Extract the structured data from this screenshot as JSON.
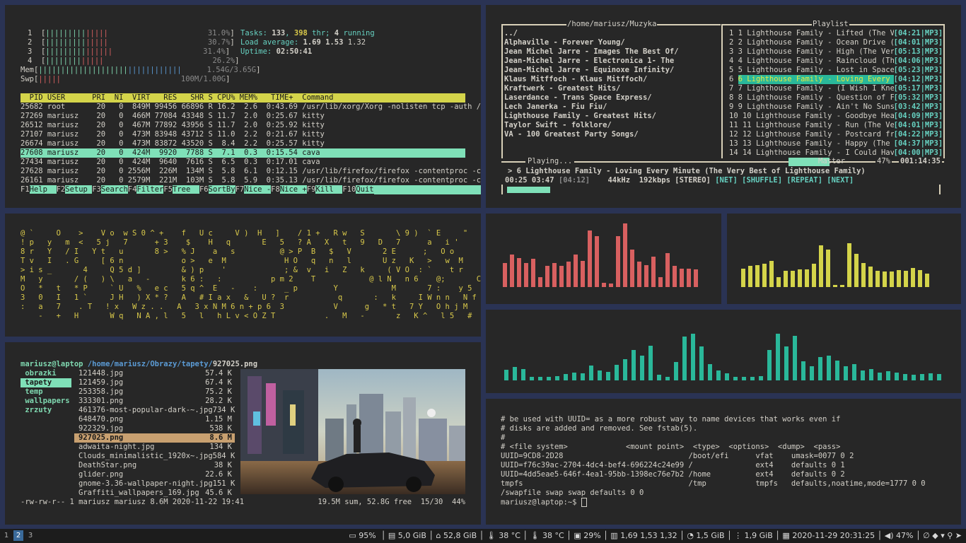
{
  "htop": {
    "cpu_meters": [
      {
        "n": "1",
        "bar": "|||||||||",
        "bar_r": "|||||",
        "pct": "31.0%"
      },
      {
        "n": "2",
        "bar": "|||||||||",
        "bar_r": "|||||",
        "pct": "30.7%"
      },
      {
        "n": "3",
        "bar": "|||||||||",
        "bar_r": "||||||",
        "pct": "31.4%"
      },
      {
        "n": "4",
        "bar": "||||||||",
        "bar_r": "|||||",
        "pct": "26.2%"
      }
    ],
    "mem": {
      "label": "Mem",
      "bar": "||||||||||||||||||||",
      "bar_b": "||||||||||||",
      "val": "1.54G/3.65G"
    },
    "swp": {
      "label": "Swp",
      "bar_r": "|||||",
      "val": "100M/1.00G"
    },
    "tasks": {
      "prefix": "Tasks: ",
      "tasks": "133",
      "sep": ", ",
      "thr": "398",
      "thr_label": " thr; ",
      "running": "4",
      "running_label": " running"
    },
    "load": {
      "prefix": "Load average: ",
      "l1": "1.69",
      "l5": "1.53",
      "l15": "1.32"
    },
    "uptime": {
      "prefix": "Uptime: ",
      "value": "02:50:41"
    },
    "header": "  PID USER      PRI  NI  VIRT   RES   SHR S CPU% MEM%   TIME+  Command",
    "processes": [
      {
        "line": "25682 root       20   0  849M 99456 66896 R 16.2  2.6  0:43.69 /usr/lib/xorg/Xorg -nolisten tcp -auth /",
        "selected": false
      },
      {
        "line": "27269 mariusz    20   0  466M 77084 43348 S 11.7  2.0  0:25.67 kitty",
        "selected": false
      },
      {
        "line": "26512 mariusz    20   0  467M 77892 43956 S 11.7  2.0  0:25.92 kitty",
        "selected": false
      },
      {
        "line": "27107 mariusz    20   0  473M 83948 43712 S 11.0  2.2  0:21.67 kitty",
        "selected": false
      },
      {
        "line": "26674 mariusz    20   0  473M 83872 43520 S  8.4  2.2  0:25.57 kitty",
        "selected": false
      },
      {
        "line": "27608 mariusz    20   0  424M  9920  7788 S  7.1  0.3  0:15.54 cava",
        "selected": true
      },
      {
        "line": "27434 mariusz    20   0  424M  9640  7616 S  6.5  0.3  0:17.01 cava",
        "selected": false
      },
      {
        "line": "27628 mariusz    20   0 2556M  226M  134M S  5.8  6.1  0:12.15 /usr/lib/firefox/firefox -contentproc -c",
        "selected": false
      },
      {
        "line": "26161 mariusz    20   0 2579M  221M  103M S  5.8  5.9  0:35.13 /usr/lib/firefox/firefox -contentproc -c",
        "selected": false
      }
    ],
    "fkeys": [
      {
        "k": "F1",
        "l": "Help  "
      },
      {
        "k": "F2",
        "l": "Setup "
      },
      {
        "k": "F3",
        "l": "Search"
      },
      {
        "k": "F4",
        "l": "Filter"
      },
      {
        "k": "F5",
        "l": "Tree  "
      },
      {
        "k": "F6",
        "l": "SortBy"
      },
      {
        "k": "F7",
        "l": "Nice -"
      },
      {
        "k": "F8",
        "l": "Nice +"
      },
      {
        "k": "F9",
        "l": "Kill  "
      },
      {
        "k": "F10",
        "l": "Quit"
      }
    ]
  },
  "cmus": {
    "browser_title": "/home/mariusz/Muzyka",
    "browser_items": [
      "../",
      "Alphaville - Forever Young/",
      "Jean Michel Jarre - Images The Best Of/",
      "Jean-Michel Jarre - Electronica 1- The",
      "Jean-Michel Jarre - Equinoxe Infinity/",
      "Klaus Mitffoch - Klaus Mitffoch/",
      "Kraftwerk - Greatest Hits/",
      "Laserdance - Trans Space Express/",
      "Lech Janerka - Fiu Fiu/",
      "Lighthouse Family - Greatest Hits/",
      "Taylor Swift - folklore/",
      "VA - 100 Greatest Party Songs/"
    ],
    "playlist_title": "Playlist",
    "playlist": [
      {
        "n": "1 ",
        "t": "1 Lighthouse Family - Lifted (The Ver",
        "d": "[04:21|MP3]"
      },
      {
        "n": "2 ",
        "t": "2 Lighthouse Family - Ocean Drive (Th",
        "d": "[04:01|MP3]"
      },
      {
        "n": "3 ",
        "t": "3 Lighthouse Family - High (The Very ",
        "d": "[05:13|MP3]"
      },
      {
        "n": "4 ",
        "t": "4 Lighthouse Family - Raincloud (The ",
        "d": "[04:06|MP3]"
      },
      {
        "n": "5 ",
        "t": "5 Lighthouse Family - Lost in Space (",
        "d": "[05:23|MP3]"
      },
      {
        "n": "6 ",
        "t": "6 Lighthouse Family - Loving Every Mi",
        "d": "[04:12|MP3]"
      },
      {
        "n": "7 ",
        "t": "7 Lighthouse Family - (I Wish I Knew ",
        "d": "[05:17|MP3]"
      },
      {
        "n": "8 ",
        "t": "8 Lighthouse Family - Question of Fai",
        "d": "[05:32|MP3]"
      },
      {
        "n": "9 ",
        "t": "9 Lighthouse Family - Ain't No Sunshi",
        "d": "[03:42|MP3]"
      },
      {
        "n": "10",
        "t": " 10 Lighthouse Family - Goodbye Heartb",
        "d": "[04:09|MP3]"
      },
      {
        "n": "11",
        "t": " 11 Lighthouse Family - Run (The Very ",
        "d": "[04:01|MP3]"
      },
      {
        "n": "12",
        "t": " 12 Lighthouse Family - Postcard from ",
        "d": "[04:22|MP3]"
      },
      {
        "n": "13",
        "t": " 13 Lighthouse Family - Happy (The Ver",
        "d": "[04:37|MP3]"
      },
      {
        "n": "14",
        "t": " 14 Lighthouse Family - I Could Have L",
        "d": "[04:00|MP3]"
      }
    ],
    "playing_label": "Playing...",
    "volume_label": "Master",
    "volume_pct": "47%",
    "elapsed_total": "001:14:35",
    "now_playing": "> 6 Lighthouse Family - Loving Every Minute (The Very Best of Lighthouse Family)",
    "time_pos": "00:25 03:47",
    "duration": "[04:12]",
    "khz": "44kHz",
    "kbps": "192kbps",
    "stereo": "[STEREO]",
    "flags": "[NET] [SHUFFLE] [REPEAT] [NEXT]",
    "volume_level": 0.47,
    "progress_level": 0.1
  },
  "matrix": {
    "rows": [
      "@ `     O    >    V o  w S 0 ^ +    f   U c     V )  H   ]    / 1 +   R w   S       \\ 9 )  ` E     \"",
      "! p   y   m  <   5 j   7      + 3    $    H   q       E   5   ? A   X   t   9   D   7      a   i '      r",
      "8 r   Y   / I   Y t   u       8 >   % J    a   s          @ > P  B   $   V       2 E      ;   O o      n",
      "T v   I   . G     [ 6 n             o >   e  M             H O   q   n   l       U z   K   >   w  M     d",
      "> i s _       4     Q 5 d ]         & ) p    '             ; &  v   i   Z   k     ( V O  : `    t r     r",
      "M   y       / (   ) \\   a   -       k 6 :   :           p m 2    T            @ l N   n 6    @;       C",
      "O   *   t   * P     ` U   %   e c   5 q ^  E   -    :      _ p        Y            M       7 :    y 5   Z / i",
      "3   0   I   1 `     J H   ) X * ?   A   # I a x   &   U ?  r           q       :   k     I W n n   N f   O h s",
      ":   a   7    . T   ! x   W z . .   A   3 x N M 6 n + p 6  3           V      g   * t   7 Y   O h j M   r H",
      "    -   +   H       W q   N A , l   5   l   h L v < O Z T           .   M   -       z   K ^   l 5   #   \\ c"
    ]
  },
  "vis": {
    "red": [
      0.28,
      0.38,
      0.34,
      0.28,
      0.33,
      0.12,
      0.25,
      0.28,
      0.25,
      0.3,
      0.38,
      0.31,
      0.67,
      0.6,
      0.05,
      0.04,
      0.6,
      0.75,
      0.44,
      0.3,
      0.26,
      0.36,
      0.12,
      0.4,
      0.25,
      0.22,
      0.22,
      0.21
    ],
    "yellow": [
      0.24,
      0.27,
      0.28,
      0.3,
      0.34,
      0.13,
      0.21,
      0.21,
      0.23,
      0.23,
      0.3,
      0.54,
      0.48,
      0.03,
      0.03,
      0.56,
      0.43,
      0.31,
      0.26,
      0.21,
      0.2,
      0.2,
      0.22,
      0.21,
      0.25,
      0.22,
      0.17
    ],
    "teal": [
      0.15,
      0.19,
      0.16,
      0.05,
      0.05,
      0.05,
      0.06,
      0.09,
      0.11,
      0.1,
      0.21,
      0.14,
      0.12,
      0.22,
      0.3,
      0.43,
      0.35,
      0.49,
      0.08,
      0.05,
      0.26,
      0.62,
      0.66,
      0.48,
      0.23,
      0.14,
      0.1,
      0.05,
      0.05,
      0.05,
      0.06,
      0.43,
      0.66,
      0.48,
      0.63,
      0.27,
      0.2,
      0.33,
      0.35,
      0.28,
      0.2,
      0.23,
      0.14,
      0.16,
      0.11,
      0.13,
      0.11,
      0.09,
      0.08,
      0.09,
      0.1,
      0.09
    ],
    "colors": {
      "red": "#d86060",
      "yellow": "#d4d44a",
      "teal": "#2ab89a"
    }
  },
  "ranger": {
    "user_host": "mariusz@laptop",
    "path_prefix": " /home/mariusz/Obrazy/tapety/",
    "path_file": "927025.png",
    "dirs": [
      {
        "name": " obrazki",
        "active": false
      },
      {
        "name": " tapety",
        "active": true
      },
      {
        "name": " temp",
        "active": false
      },
      {
        "name": " wallpapers",
        "active": false
      },
      {
        "name": " zrzuty",
        "active": false
      }
    ],
    "files": [
      {
        "name": "121448.jpg",
        "size": "57.4 K",
        "selected": false
      },
      {
        "name": "121459.jpg",
        "size": "67.4 K",
        "selected": false
      },
      {
        "name": "253358.jpg",
        "size": "75.2 K",
        "selected": false
      },
      {
        "name": "333301.png",
        "size": "28.2 K",
        "selected": false
      },
      {
        "name": "461376-most-popular-dark-~.jpg",
        "size": "734 K",
        "selected": false
      },
      {
        "name": "648470.png",
        "size": "1.15 M",
        "selected": false
      },
      {
        "name": "922329.jpg",
        "size": "538 K",
        "selected": false
      },
      {
        "name": "927025.png",
        "size": "8.6 M",
        "selected": true
      },
      {
        "name": "adwaita-night.jpg",
        "size": "134 K",
        "selected": false
      },
      {
        "name": "Clouds_minimalistic_1920x~.jpg",
        "size": "584 K",
        "selected": false
      },
      {
        "name": "DeathStar.png",
        "size": "38 K",
        "selected": false
      },
      {
        "name": "glider.png",
        "size": "22.6 K",
        "selected": false
      },
      {
        "name": "gnome-3.36-wallpaper-night.jpg",
        "size": "151 K",
        "selected": false
      },
      {
        "name": "Graffiti_wallpapers_169.jpg",
        "size": "45.6 K",
        "selected": false
      }
    ],
    "status_left": "-rw-rw-r-- 1 mariusz mariusz 8.6M 2020-11-22 19:41",
    "status_right": "19.5M sum, 52.8G free  15/30  44%"
  },
  "term": {
    "lines": [
      "# be used with UUID= as a more robust way to name devices that works even if",
      "# disks are added and removed. See fstab(5).",
      "#",
      "# <file system>             <mount point>  <type>  <options>  <dump>  <pass>",
      "UUID=9CD8-2D28                            /boot/efi      vfat    umask=0077 0 2",
      "UUID=f76c39ac-2704-4dc4-bef4-696224c24e99 /              ext4    defaults 0 1",
      "UUID=4dd5eae5-646f-4ea1-95bb-1398ec76e7b2 /home          ext4    defaults 0 2",
      "tmpfs                                     /tmp           tmpfs   defaults,noatime,mode=1777 0 0",
      "/swapfile swap swap defaults 0 0"
    ],
    "prompt": "mariusz@laptop:~$ "
  },
  "statusbar": {
    "workspaces": [
      {
        "n": "1",
        "active": false
      },
      {
        "n": "2",
        "active": true
      },
      {
        "n": "3",
        "active": false
      }
    ],
    "battery": "95%",
    "ram_free": "5,0 GiB",
    "home_free": "52,8 GiB",
    "temp1": "38 °C",
    "temp2": "38 °C",
    "cpu": "29%",
    "load": "1,69 1,53 1,32",
    "mem_used": "1,5 GiB",
    "swap": "1,9 GiB",
    "datetime": "2020-11-29 20:31:25",
    "volume": "47%"
  }
}
